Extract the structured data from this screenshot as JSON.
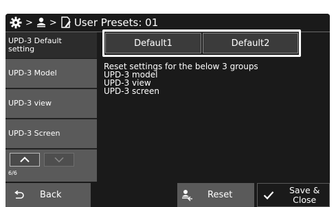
{
  "header": {
    "title": "User Presets: 01",
    "separator": ">",
    "icons": [
      "gear-icon",
      "user-icon",
      "document-edit-icon"
    ]
  },
  "sidebar": {
    "items": [
      {
        "label": "UPD-3 Default\nsetting",
        "active": true
      },
      {
        "label": "UPD-3 Model",
        "active": false
      },
      {
        "label": "UPD-3 view",
        "active": false
      },
      {
        "label": "UPD-3 Screen",
        "active": false
      }
    ],
    "pager": {
      "up_icon": "chevron-up-icon",
      "down_icon": "chevron-down-icon",
      "page": "6/6"
    }
  },
  "main": {
    "buttons": [
      {
        "label": "Default1"
      },
      {
        "label": "Default2"
      }
    ],
    "description": "Reset settings for the below 3 groups\nUPD-3 model\nUPD-3 view\nUPD-3 screen"
  },
  "footer": {
    "back_label": "Back",
    "reset_label": "Reset",
    "save_label": "Save &\nClose"
  },
  "colors": {
    "background": "#1a1a1a",
    "button_gray": "#5a5a5a",
    "text": "#ffffff"
  }
}
